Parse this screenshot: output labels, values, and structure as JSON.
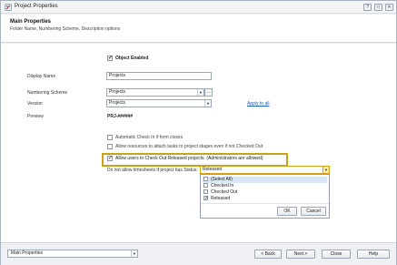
{
  "window": {
    "title": "Project Properties",
    "controls": [
      "?",
      "□",
      "✕"
    ]
  },
  "header": {
    "title": "Main Properties",
    "subtitle": "Folder Name, Numbering Scheme, Description options"
  },
  "form": {
    "object_enabled_label": "Object Enabled",
    "object_enabled_checked": true,
    "display_name_label": "Display Name",
    "display_name_value": "Projects",
    "numbering_scheme_label": "Numbering Scheme",
    "numbering_scheme_value": "Projects",
    "version_label": "Version",
    "version_value": "Projects",
    "apply_to_all_label": "Apply to all",
    "preview_label": "Preview",
    "preview_value": "PRJ-######",
    "auto_checkin_label": "Automatic Check In if form closes",
    "auto_checkin_checked": false,
    "allow_attach_label": "Allow resources to attach tasks to project stages even if not Checked Out",
    "allow_attach_checked": false,
    "allow_checkout_label": "Allow users to Check Out Released projects. (Administrators are allowed)",
    "allow_checkout_checked": true,
    "timesheet_label": "Do not allow timesheets if project has Status:",
    "timesheet_value": "Released"
  },
  "status_popup": {
    "options": [
      {
        "label": "(Select All)",
        "checked": false
      },
      {
        "label": "Checked In",
        "checked": false
      },
      {
        "label": "Checked Out",
        "checked": false
      },
      {
        "label": "Released",
        "checked": true
      }
    ],
    "ok_label": "OK",
    "cancel_label": "Cancel"
  },
  "footer": {
    "nav_value": "Main Properties",
    "back_label": "< Back",
    "next_label": "Next >",
    "close_label": "Close",
    "help_label": "Help"
  },
  "colors": {
    "highlight_border": "#c8a415",
    "link": "#1f5fbf"
  }
}
